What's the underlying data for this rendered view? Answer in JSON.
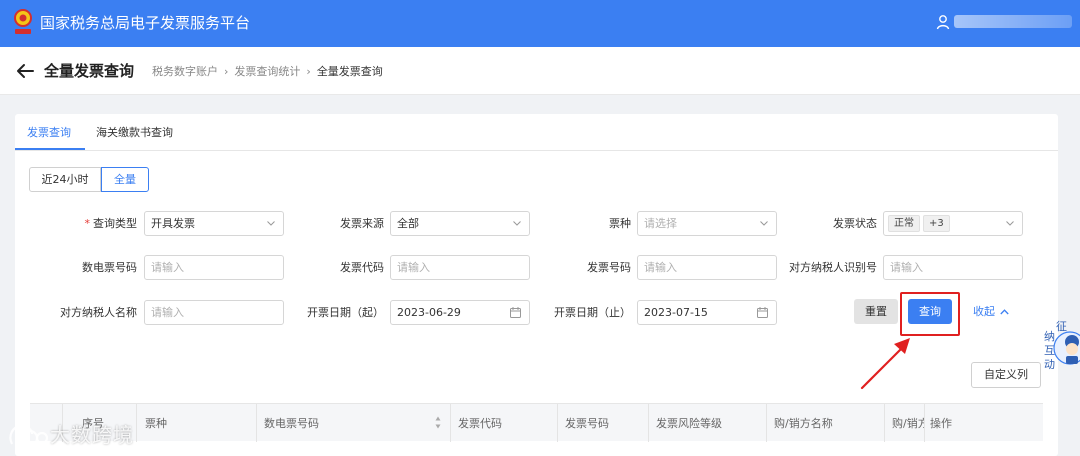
{
  "app": {
    "title": "国家税务总局电子发票服务平台"
  },
  "header": {
    "page_title": "全量发票查询"
  },
  "breadcrumb": [
    "税务数字账户",
    "发票查询统计",
    "全量发票查询"
  ],
  "tabs": [
    {
      "label": "发票查询",
      "active": true
    },
    {
      "label": "海关缴款书查询",
      "active": false
    }
  ],
  "time_range": {
    "options": [
      "近24小时",
      "全量"
    ],
    "selected": "全量"
  },
  "form": {
    "query_type": {
      "label": "查询类型",
      "required": true,
      "value": "开具发票"
    },
    "invoice_source": {
      "label": "发票来源",
      "value": "全部"
    },
    "invoice_kind": {
      "label": "票种",
      "placeholder": "请选择"
    },
    "invoice_status": {
      "label": "发票状态",
      "tag": "正常",
      "more": "+3"
    },
    "digital_invoice_no": {
      "label": "数电票号码",
      "placeholder": "请输入"
    },
    "invoice_code": {
      "label": "发票代码",
      "placeholder": "请输入"
    },
    "invoice_no": {
      "label": "发票号码",
      "placeholder": "请输入"
    },
    "counterparty_tax_id": {
      "label": "对方纳税人识别号",
      "placeholder": "请输入"
    },
    "counterparty_name": {
      "label": "对方纳税人名称",
      "placeholder": "请输入"
    },
    "date_start": {
      "label": "开票日期（起）",
      "value": "2023-06-29"
    },
    "date_end": {
      "label": "开票日期（止）",
      "value": "2023-07-15"
    }
  },
  "actions": {
    "reset": "重置",
    "query": "查询",
    "collapse": "收起",
    "customize_columns": "自定义列"
  },
  "table": {
    "columns": [
      "序号",
      "票种",
      "数电票号码",
      "发票代码",
      "发票号码",
      "发票风险等级",
      "购/销方名称",
      "购/销方",
      "操作"
    ]
  },
  "side_widget": {
    "text": [
      "征",
      "纳",
      "互",
      "动"
    ]
  },
  "watermark": "大数跨境",
  "colors": {
    "primary": "#3b7ff2",
    "highlight": "#e02020",
    "header_bg": "#3b7ff2"
  }
}
